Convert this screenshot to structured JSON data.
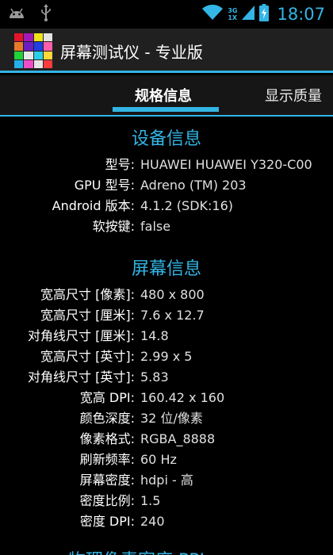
{
  "status_bar": {
    "time": "18:07",
    "network_top": "3G",
    "network_bottom": "1X",
    "icons": [
      "android-debug-icon",
      "usb-icon",
      "wifi-icon",
      "signal-icon",
      "battery-charging-icon"
    ],
    "accent_color": "#33b5e5"
  },
  "action_bar": {
    "title": "屏幕测试仪 - 专业版",
    "icon": "color-grid-icon"
  },
  "tabs": [
    {
      "label": "规格信息",
      "active": true
    },
    {
      "label": "显示质量",
      "active": false
    }
  ],
  "device_info": {
    "title": "设备信息",
    "rows": [
      {
        "label": "型号:",
        "value": "HUAWEI HUAWEI Y320-C00"
      },
      {
        "label": "GPU 型号:",
        "value": "Adreno (TM) 203"
      },
      {
        "label": "Android 版本:",
        "value": "4.1.2    (SDK:16)"
      },
      {
        "label": "软按键:",
        "value": "false"
      }
    ]
  },
  "screen_info": {
    "title": "屏幕信息",
    "rows": [
      {
        "label": "宽高尺寸 [像素]:",
        "value": "480 x 800"
      },
      {
        "label": "宽高尺寸 [厘米]:",
        "value": "7.6 x 12.7"
      },
      {
        "label": "对角线尺寸 [厘米]:",
        "value": "14.8"
      },
      {
        "label": "宽高尺寸 [英寸]:",
        "value": "2.99 x 5"
      },
      {
        "label": "对角线尺寸 [英寸]:",
        "value": "5.83"
      },
      {
        "label": "宽高 DPI:",
        "value": "160.42 x 160"
      },
      {
        "label": "颜色深度:",
        "value": "32 位/像素"
      },
      {
        "label": "像素格式:",
        "value": "RGBA_8888"
      },
      {
        "label": "刷新频率:",
        "value": "60 Hz"
      },
      {
        "label": "屏幕密度:",
        "value": "hdpi - 高"
      },
      {
        "label": "密度比例:",
        "value": "1.5"
      },
      {
        "label": "密度 DPI:",
        "value": "240"
      }
    ]
  },
  "next_section": {
    "title": "物理像素密度 PPI"
  }
}
